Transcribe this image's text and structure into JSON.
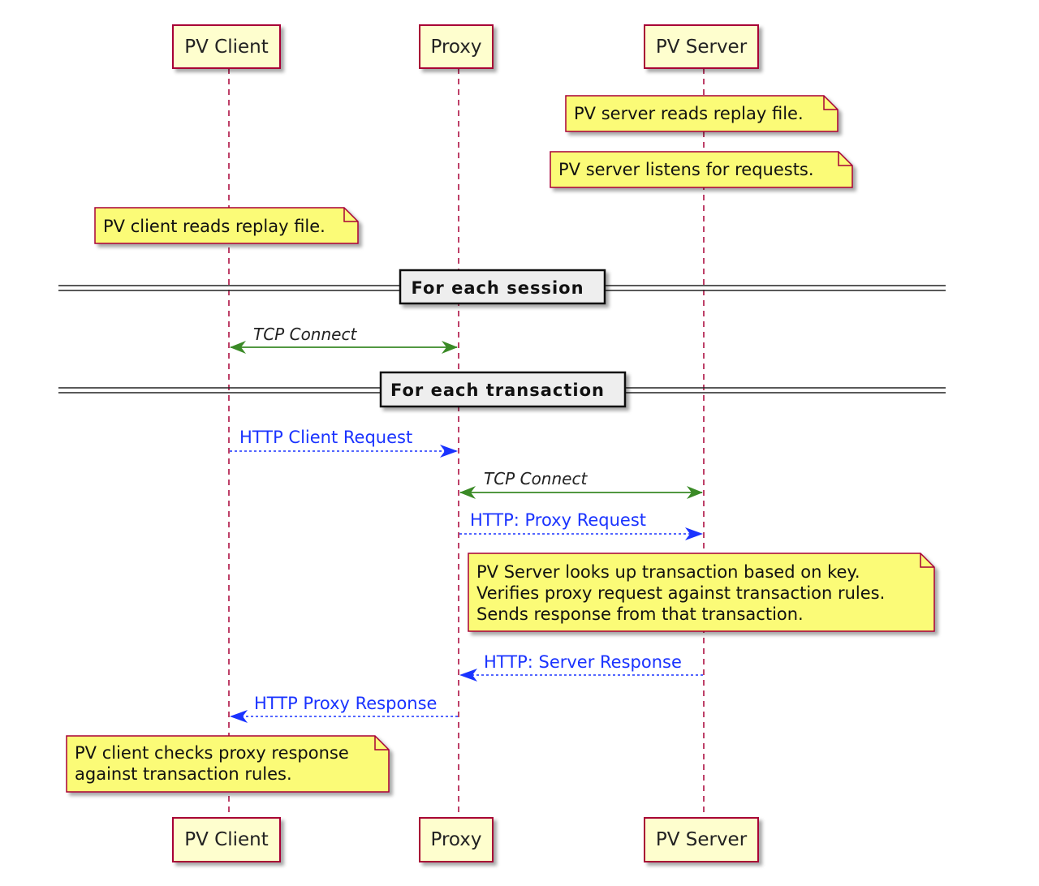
{
  "colors": {
    "participant_fill": "#fefece",
    "participant_border": "#a80036",
    "note_fill": "#fbfb77",
    "note_border": "#a80036",
    "divider_fill": "#eeeeee",
    "tcp_arrow": "#3a8a26",
    "http_arrow": "#1a33ff"
  },
  "participants": [
    "PV Client",
    "Proxy",
    "PV Server"
  ],
  "notes": {
    "server_reads": "PV server reads replay file.",
    "server_listens": "PV server listens for requests.",
    "client_reads": "PV client reads replay file.",
    "server_lookup": [
      "PV Server looks up transaction based on key.",
      "Verifies proxy request against transaction rules.",
      "Sends response from that transaction."
    ],
    "client_checks": [
      "PV client checks proxy response",
      "against transaction rules."
    ]
  },
  "dividers": [
    "For each session",
    "For each transaction"
  ],
  "messages": [
    {
      "from": "PV Client",
      "to": "Proxy",
      "label": "TCP Connect",
      "style": "bidirectional-solid"
    },
    {
      "from": "PV Client",
      "to": "Proxy",
      "label": "HTTP Client Request",
      "style": "dashed"
    },
    {
      "from": "Proxy",
      "to": "PV Server",
      "label": "TCP Connect",
      "style": "bidirectional-solid"
    },
    {
      "from": "Proxy",
      "to": "PV Server",
      "label": "HTTP: Proxy Request",
      "style": "dashed"
    },
    {
      "from": "PV Server",
      "to": "Proxy",
      "label": "HTTP: Server Response",
      "style": "dashed"
    },
    {
      "from": "Proxy",
      "to": "PV Client",
      "label": "HTTP Proxy Response",
      "style": "dashed"
    }
  ]
}
